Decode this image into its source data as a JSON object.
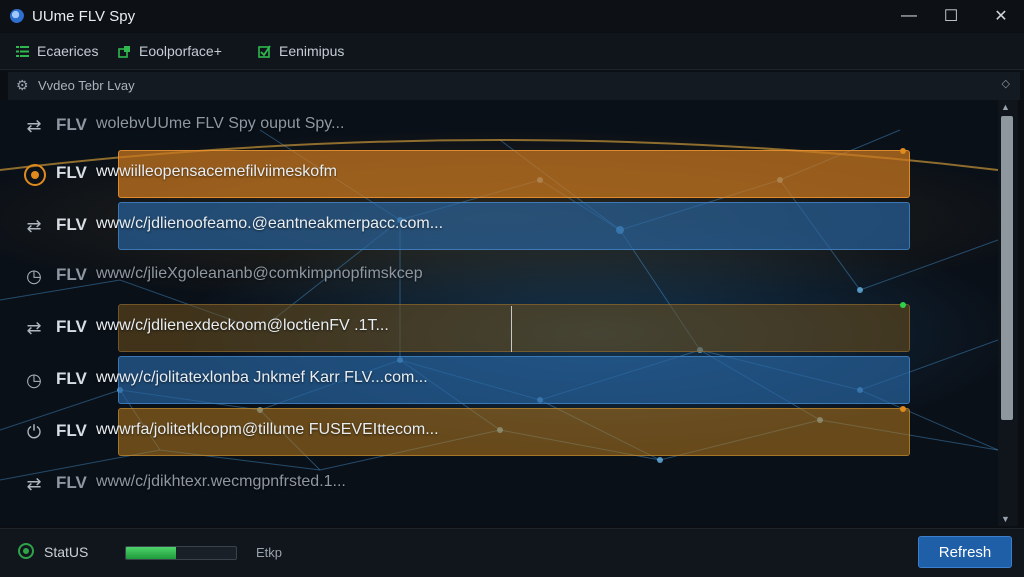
{
  "window": {
    "title": "UUme FLV Spy",
    "controls": {
      "minimize": "—",
      "maximize": "☐",
      "close": "✕"
    }
  },
  "menu": {
    "items": [
      {
        "label": "Ecaerices",
        "icon": "list-icon",
        "color": "#2fb84e"
      },
      {
        "label": "Eoolporface+",
        "icon": "puzzle-icon",
        "color": "#2fb84e"
      },
      {
        "label": "Eenimipus",
        "icon": "checkbox-icon",
        "color": "#2fb84e"
      }
    ]
  },
  "subbar": {
    "label": "Vvdeo Tebr Lvay",
    "icon": "gear-icon",
    "caret": "◇"
  },
  "rows": [
    {
      "type": "FLV",
      "text": "wolebvUUme FLV Spy  ouput Spy...",
      "icon": "arrows-icon",
      "style": "none",
      "dim": true
    },
    {
      "type": "FLV",
      "text": "wwwiilleopensacemefilviimeskofm",
      "icon": "ring-icon",
      "style": "orange",
      "dot": "#e08a1e"
    },
    {
      "type": "FLV",
      "text": "www/c/jdlienoofeamo.@eantneakmerpacc.com...",
      "icon": "arrows-icon",
      "style": "blue"
    },
    {
      "type": "FLV",
      "text": "www/c/jlieXgoleananb@comkimpnopfimskcep",
      "icon": "clock-icon",
      "style": "none",
      "dim": true
    },
    {
      "type": "FLV",
      "text": "www/c/jdlienexdeckoom@loctienFV .1T...",
      "icon": "arrows-icon",
      "style": "brown",
      "dot": "#2fd14a"
    },
    {
      "type": "FLV",
      "text": "wwwy/c/jolitatexlonba Jnkmef Karr FLV...com...",
      "icon": "clock-icon",
      "style": "blue"
    },
    {
      "type": "FLV",
      "text": "wwwrfa/jolitetklcopm@tillume FUSEVEIttecom...",
      "icon": "power-icon",
      "style": "gold",
      "dot": "#e08a1e"
    },
    {
      "type": "FLV",
      "text": "www/c/jdikhtexr.wecmgpnfrsted.1...",
      "icon": "arrows-icon",
      "style": "none",
      "dim": true
    }
  ],
  "scrollbar": {
    "up": "▲",
    "down": "▼"
  },
  "status": {
    "label": "StatUS",
    "progress": 0.45,
    "text": "Etkp",
    "refresh_label": "Refresh"
  }
}
